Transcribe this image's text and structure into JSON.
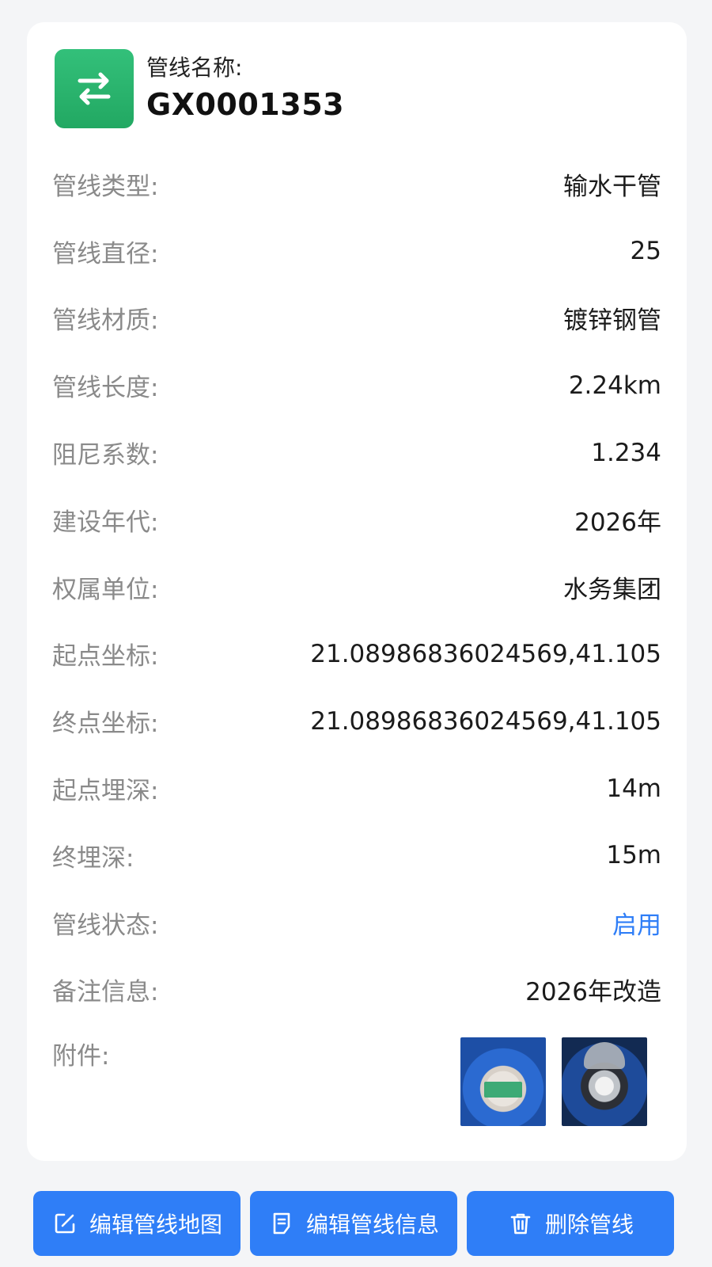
{
  "header": {
    "name_label": "管线名称:",
    "name_value": "GX0001353",
    "icon": "swap-arrows-icon",
    "icon_color": "#2bb56e"
  },
  "details": [
    {
      "label": "管线类型:",
      "value": "输水干管"
    },
    {
      "label": "管线直径:",
      "value": "25"
    },
    {
      "label": "管线材质:",
      "value": "镀锌钢管"
    },
    {
      "label": "管线长度:",
      "value": "2.24km"
    },
    {
      "label": "阻尼系数:",
      "value": "1.234"
    },
    {
      "label": "建设年代:",
      "value": "2026年"
    },
    {
      "label": "权属单位:",
      "value": "水务集团"
    },
    {
      "label": "起点坐标:",
      "value": "21.08986836024569,41.105"
    },
    {
      "label": "终点坐标:",
      "value": "21.08986836024569,41.105"
    },
    {
      "label": "起点埋深:",
      "value": "14m"
    },
    {
      "label": "终埋深:",
      "value": "15m"
    },
    {
      "label": "管线状态:",
      "value": "启用"
    },
    {
      "label": "备注信息:",
      "value": "2026年改造"
    }
  ],
  "attachments": {
    "label": "附件:",
    "items": [
      "water-meter-photo",
      "water-meter-photo"
    ]
  },
  "actions": [
    {
      "label": "编辑管线地图",
      "icon": "edit-icon"
    },
    {
      "label": "编辑管线信息",
      "icon": "document-icon"
    },
    {
      "label": "删除管线",
      "icon": "trash-icon"
    }
  ],
  "colors": {
    "primary": "#2f7ef7",
    "status": "#2f7ef7",
    "label": "#8a8a8a",
    "background": "#f4f5f7"
  }
}
